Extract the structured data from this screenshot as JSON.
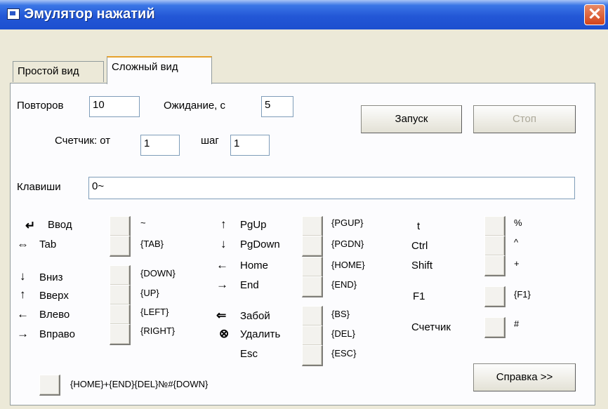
{
  "window": {
    "title": "Эмулятор нажатий",
    "close_glyph": "✕"
  },
  "tabs": [
    {
      "label": "Простой вид",
      "selected": false
    },
    {
      "label": "Сложный вид",
      "selected": true
    }
  ],
  "settings": {
    "repeats_label": "Повторов",
    "repeats_value": "10",
    "wait_label": "Ожидание, с",
    "wait_value": "5",
    "counter_label": "Счетчик:  от",
    "counter_from": "1",
    "step_label": "шаг",
    "step_value": "1"
  },
  "buttons": {
    "start": "Запуск",
    "stop": "Стоп",
    "help": "Справка >>"
  },
  "keys": {
    "label": "Клавиши",
    "value": "0~"
  },
  "col1": [
    {
      "icon": "enter-arrow-icon",
      "glyph": "↵",
      "label": "Ввод",
      "code": "~"
    },
    {
      "icon": "double-arrow-icon",
      "glyph": "⇔",
      "label": "Tab",
      "code": "{TAB}"
    },
    {
      "icon": "down-arrow-icon",
      "glyph": "↓",
      "label": "Вниз",
      "code": "{DOWN}"
    },
    {
      "icon": "up-arrow-icon",
      "glyph": "↑",
      "label": "Вверх",
      "code": "{UP}"
    },
    {
      "icon": "left-arrow-icon",
      "glyph": "←",
      "label": "Влево",
      "code": "{LEFT}"
    },
    {
      "icon": "right-arrow-icon",
      "glyph": "→",
      "label": "Вправо",
      "code": "{RIGHT}"
    }
  ],
  "col2": [
    {
      "icon": "up-arrow-icon",
      "glyph": "↑",
      "label": "PgUp",
      "code": "{PGUP}"
    },
    {
      "icon": "down-arrow-icon",
      "glyph": "↓",
      "label": "PgDown",
      "code": "{PGDN}"
    },
    {
      "icon": "left-arrow-icon",
      "glyph": "←",
      "label": "Home",
      "code": "{HOME}"
    },
    {
      "icon": "right-arrow-icon",
      "glyph": "→",
      "label": "End",
      "code": "{END}"
    },
    {
      "icon": "backspace-arrow-icon",
      "glyph": "⇐",
      "label": "Забой",
      "code": "{BS}"
    },
    {
      "icon": "delete-icon",
      "glyph": "⊗",
      "label": "Удалить",
      "code": "{DEL}"
    },
    {
      "icon": "",
      "glyph": "",
      "label": "Esc",
      "code": "{ESC}"
    }
  ],
  "col3": [
    {
      "label": "t",
      "code": "%"
    },
    {
      "label": "Ctrl",
      "code": "^"
    },
    {
      "label": "Shift",
      "code": "+"
    },
    {
      "label": "F1",
      "code": "{F1}"
    },
    {
      "label": "Счетчик",
      "code": "#"
    }
  ],
  "macro": {
    "text": "{HOME}+{END}{DEL}№#{DOWN}"
  }
}
